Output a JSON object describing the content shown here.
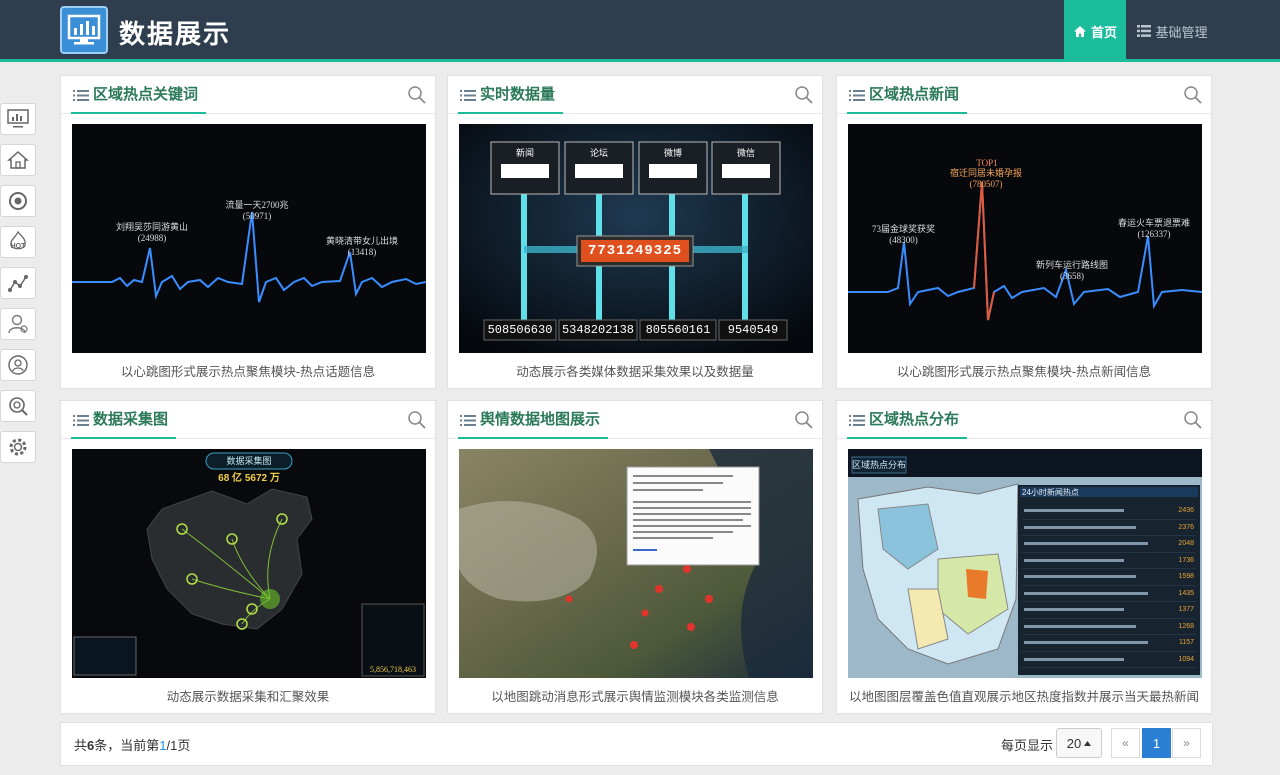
{
  "header": {
    "app_title": "数据展示",
    "nav": [
      {
        "label": "首页"
      },
      {
        "label": "基础管理"
      }
    ]
  },
  "sidebar": {
    "icons": [
      "monitor-icon",
      "home-icon",
      "refresh-icon",
      "hot-icon",
      "trend-icon",
      "user-settings-icon",
      "user-search-icon",
      "analytics-icon",
      "gear-icon"
    ]
  },
  "cards": [
    {
      "title": "区域热点关键词",
      "caption": "以心跳图形式展示热点聚焦模块-热点话题信息",
      "labels": [
        {
          "text": "刘翔吴莎同游黄山",
          "value": "(24988)"
        },
        {
          "text": "流量一天2700兆",
          "value": "(50971)"
        },
        {
          "text": "黄晓清带女儿出境",
          "value": "(13418)"
        }
      ]
    },
    {
      "title": "实时数据量",
      "caption": "动态展示各类媒体数据采集效果以及数据量",
      "boards": [
        "新闻",
        "论坛",
        "微博",
        "微信"
      ],
      "center_counter": "7731249325",
      "counters": [
        "508506630",
        "5348202138",
        "805560161",
        "9540549"
      ]
    },
    {
      "title": "区域热点新闻",
      "caption": "以心跳图形式展示热点聚焦模块-热点新闻信息",
      "top_label": "TOP1",
      "labels": [
        {
          "text": "73届金球奖获奖",
          "value": "(48300)"
        },
        {
          "text": "宿迁同居未婚孕报",
          "value": "(780507)"
        },
        {
          "text": "新列车运行路线图",
          "value": "(3658)"
        },
        {
          "text": "春运火车票退票难",
          "value": "(126337)"
        }
      ]
    },
    {
      "title": "数据采集图",
      "caption": "动态展示数据采集和汇聚效果",
      "map_title": "数据采集图",
      "total": "68 亿 5672 万",
      "stat_total": "5,856,718,463"
    },
    {
      "title": "舆情数据地图展示",
      "caption": "以地图跳动消息形式展示舆情监测模块各类监测信息"
    },
    {
      "title": "区域热点分布",
      "caption": "以地图图层覆盖色值直观展示地区热度指数并展示当天最热新闻",
      "map_label": "区域热点分布",
      "panel_title": "24小时新闻热点",
      "rows": [
        "2436",
        "2376",
        "2048",
        "1736",
        "1598",
        "1435",
        "1377",
        "1268",
        "1157",
        "1094"
      ]
    }
  ],
  "pagination": {
    "prefix": "共",
    "total": "6",
    "mid": "条，当前第",
    "current": "1",
    "suffix": "/1页",
    "page_size_label": "每页显示",
    "page_size": "20",
    "prev": "«",
    "page": "1",
    "next": "»"
  }
}
